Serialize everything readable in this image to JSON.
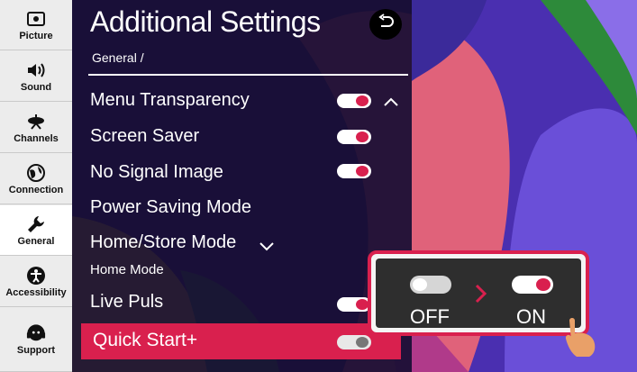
{
  "sidebar": {
    "items": [
      {
        "label": "Picture",
        "icon": "picture-icon"
      },
      {
        "label": "Sound",
        "icon": "speaker-icon"
      },
      {
        "label": "Channels",
        "icon": "antenna-icon"
      },
      {
        "label": "Connection",
        "icon": "globe-icon"
      },
      {
        "label": "General",
        "icon": "wrench-icon"
      },
      {
        "label": "Accessibility",
        "icon": "accessibility-icon"
      },
      {
        "label": "Support",
        "icon": "headset-icon"
      }
    ],
    "active": "General"
  },
  "header": {
    "title": "Additional Settings",
    "breadcrumb": "General /"
  },
  "settings": [
    {
      "label": "Menu Transparency",
      "toggle": true
    },
    {
      "label": "Screen Saver",
      "toggle": true
    },
    {
      "label": "No Signal Image",
      "toggle": true
    },
    {
      "label": "Power Saving Mode"
    },
    {
      "label": "Home/Store Mode",
      "value": "Home Mode"
    },
    {
      "label": "Live Puls",
      "toggle": true
    },
    {
      "label": "Quick Start+",
      "toggle": true,
      "highlighted": true
    }
  ],
  "popup": {
    "off_label": "OFF",
    "on_label": "ON"
  },
  "colors": {
    "accent": "#d9204e",
    "panel": "#180e34",
    "sidebar": "#ececec"
  }
}
